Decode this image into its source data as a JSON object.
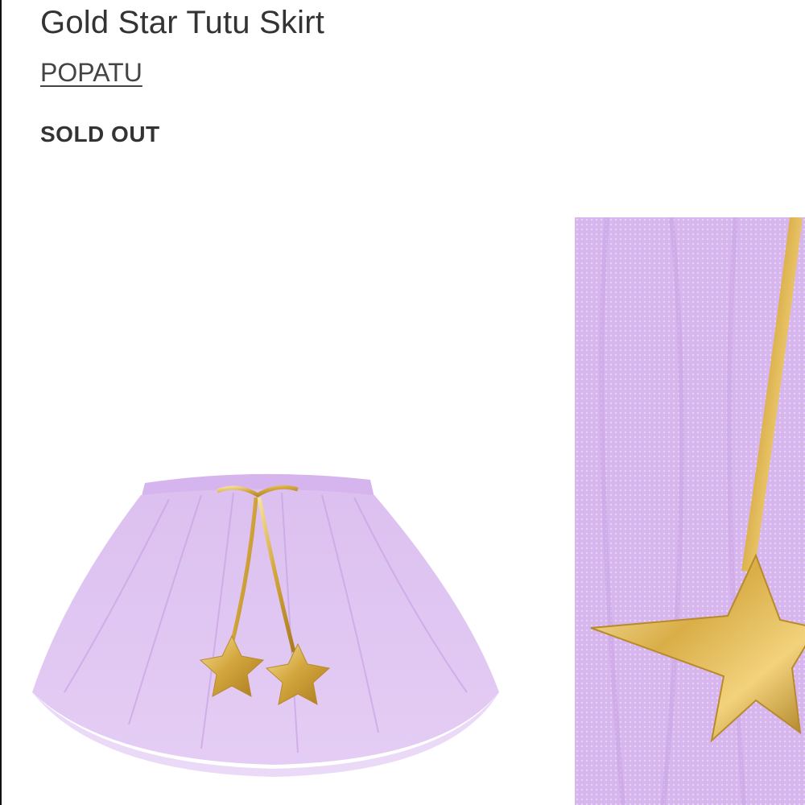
{
  "product": {
    "title": "Gold Star Tutu Skirt",
    "brand": "POPATU",
    "status": "SOLD OUT"
  },
  "colors": {
    "tulle": "#d8b8ee",
    "gold": "#d9b45a",
    "text": "#333333"
  },
  "gallery": {
    "main_image_icon": "tutu-skirt-image",
    "thumb_image_icon": "tulle-star-detail-image"
  }
}
